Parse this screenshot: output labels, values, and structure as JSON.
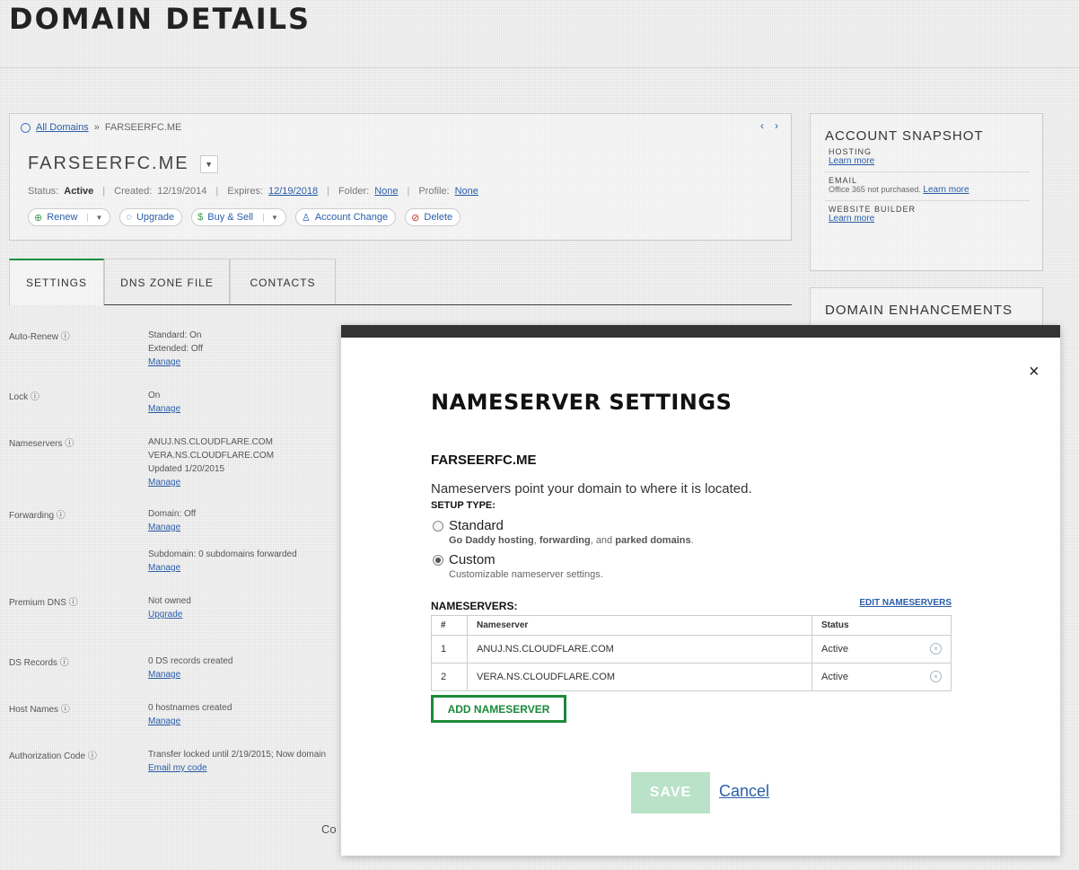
{
  "page": {
    "title": "DOMAIN DETAILS"
  },
  "domain_panel": {
    "breadcrumb_link": "All Domains",
    "breadcrumb_sep": "»",
    "breadcrumb_current": "FARSEERFC.ME",
    "prev": "‹",
    "next": "›",
    "domain_name": "FARSEERFC.ME",
    "menu_toggle": "▼",
    "status_label": "Status:",
    "status_value": "Active",
    "created_label": "Created:",
    "created_value": "12/19/2014",
    "expires_label": "Expires:",
    "expires_value": "12/19/2018",
    "folder_label": "Folder:",
    "folder_value": "None",
    "profile_label": "Profile:",
    "profile_value": "None",
    "sep": "|",
    "actions": {
      "renew": "Renew",
      "upgrade": "Upgrade",
      "buy_sell": "Buy & Sell",
      "account_change": "Account Change",
      "delete": "Delete",
      "caret": "▼"
    }
  },
  "tabs": [
    {
      "label": "SETTINGS"
    },
    {
      "label": "DNS ZONE FILE"
    },
    {
      "label": "CONTACTS"
    }
  ],
  "settings": {
    "auto_renew": {
      "label": "Auto-Renew ⓘ",
      "line1": "Standard: On",
      "line2": "Extended: Off",
      "link": "Manage"
    },
    "lock": {
      "label": "Lock ⓘ",
      "line1": "On",
      "link": "Manage"
    },
    "nameservers": {
      "label": "Nameservers ⓘ",
      "line1": "ANUJ.NS.CLOUDFLARE.COM",
      "line2": "VERA.NS.CLOUDFLARE.COM",
      "line3": "Updated 1/20/2015",
      "link": "Manage"
    },
    "forwarding": {
      "label": "Forwarding ⓘ",
      "line1": "Domain: Off",
      "link1": "Manage",
      "line2": "Subdomain: 0 subdomains forwarded",
      "link2": "Manage"
    },
    "premium_dns": {
      "label": "Premium DNS ⓘ",
      "line1": "Not owned",
      "link": "Upgrade"
    },
    "ds_records": {
      "label": "DS Records ⓘ",
      "line1": "0 DS records created",
      "link": "Manage"
    },
    "host_names": {
      "label": "Host Names ⓘ",
      "line1": "0 hostnames created",
      "link": "Manage"
    },
    "auth_code": {
      "label": "Authorization Code ⓘ",
      "line1": "Transfer locked until 2/19/2015; Now domain",
      "link": "Email my code"
    }
  },
  "cutoff_text": "Co",
  "account_snapshot": {
    "title": "ACCOUNT SNAPSHOT",
    "hosting_label": "HOSTING",
    "hosting_link": "Learn more",
    "email_label": "EMAIL",
    "email_text": "Office 365 not purchased.",
    "email_link": "Learn more",
    "website_label": "WEBSITE BUILDER",
    "website_link": "Learn more"
  },
  "domain_enhancements": {
    "title": "DOMAIN ENHANCEMENTS"
  },
  "modal": {
    "close": "×",
    "title": "NAMESERVER SETTINGS",
    "domain": "FARSEERFC.ME",
    "description": "Nameservers point your domain to where it is located.",
    "setup_label": "SETUP TYPE:",
    "options": {
      "standard": {
        "label": "Standard",
        "sub_a": "Go Daddy hosting",
        "sub_b": ", ",
        "sub_c": "forwarding",
        "sub_d": ", and ",
        "sub_e": "parked domains",
        "sub_f": ".",
        "selected": false
      },
      "custom": {
        "label": "Custom",
        "sub": "Customizable nameserver settings.",
        "selected": true
      }
    },
    "nameservers_label": "NAMESERVERS:",
    "edit_link": "EDIT NAMESERVERS",
    "table": {
      "headers": {
        "num": "#",
        "nameserver": "Nameserver",
        "status": "Status"
      },
      "rows": [
        {
          "num": "1",
          "nameserver": "ANUJ.NS.CLOUDFLARE.COM",
          "status": "Active"
        },
        {
          "num": "2",
          "nameserver": "VERA.NS.CLOUDFLARE.COM",
          "status": "Active"
        }
      ]
    },
    "add_button": "ADD NAMESERVER",
    "save_button": "SAVE",
    "cancel_link": "Cancel",
    "remove_glyph": "×"
  },
  "colors": {
    "accent_green": "#1b8a3a",
    "save_disabled": "#b9e2c8",
    "link_blue": "#2a5da8",
    "modal_bar": "#333333"
  }
}
